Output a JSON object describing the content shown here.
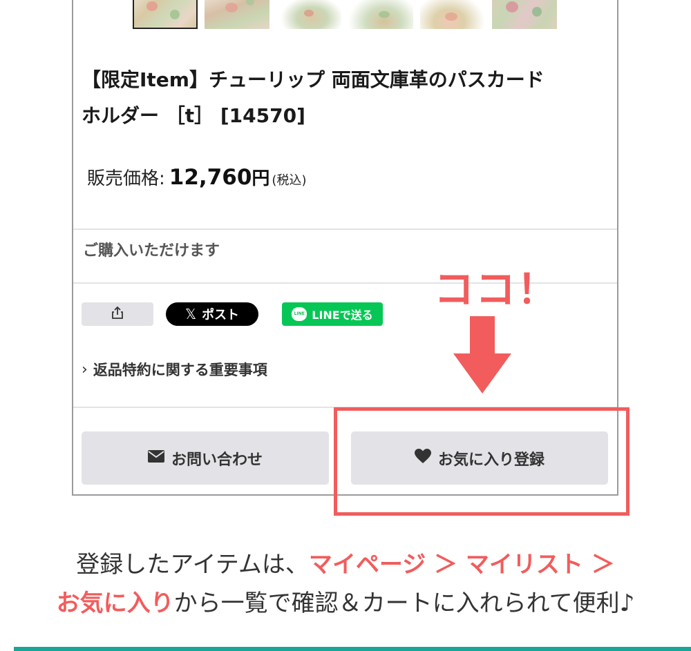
{
  "product": {
    "title_line1": "【限定Item】チューリップ 両面文庫革のパスカード",
    "title_line2": "ホルダー ［t］ [14570]",
    "price_label": "販売価格:",
    "price_value": "12,760",
    "price_currency": "円",
    "price_tax": "(税込)",
    "availability": "ご購入いただけます"
  },
  "social": {
    "share_icon": "share-icon",
    "x_mark": "𝕏",
    "x_label": "ポスト",
    "line_badge": "LINE",
    "line_label": "LINEで送る"
  },
  "returns": {
    "chevron": "›",
    "label": "返品特約に関する重要事項"
  },
  "actions": {
    "contact_label": "お問い合わせ",
    "favorite_label": "お気に入り登録"
  },
  "annotation": {
    "callout": "ココ！"
  },
  "caption": {
    "line1_text": "登録したアイテムは、",
    "line1_red": "マイページ ＞ マイリスト ＞",
    "line2_red": "お気に入り",
    "line2_text": "から一覧で確認＆カートに入れられて便利♪"
  },
  "colors": {
    "accent_red": "#f25c5c",
    "line_green": "#06c755",
    "button_gray": "#e3e3e7",
    "footer_teal": "#1aa596"
  }
}
